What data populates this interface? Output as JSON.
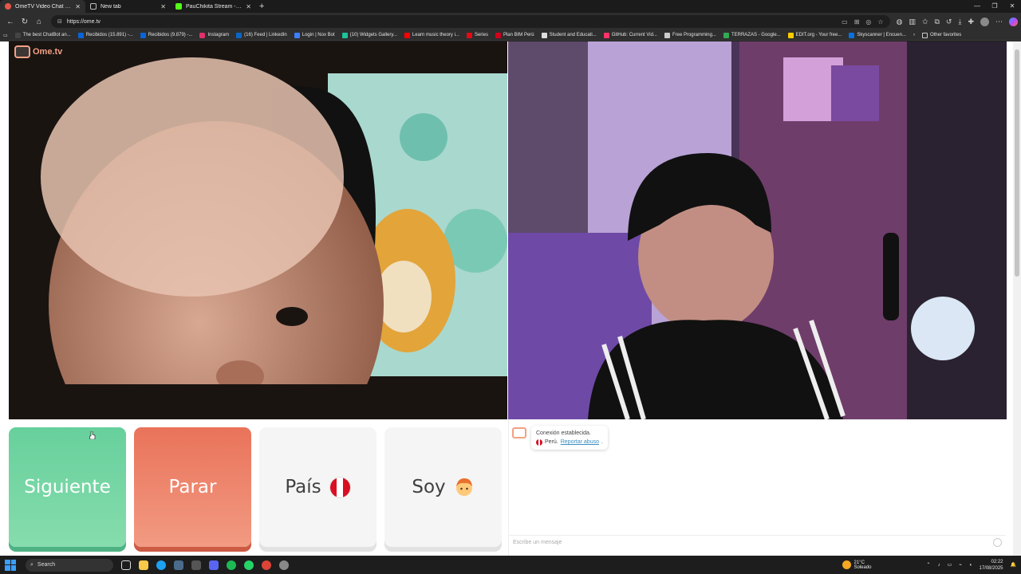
{
  "browser": {
    "tabs": [
      {
        "label": "OmeTV Video Chat — Ome.tv",
        "icon_color": "#e6564a",
        "active": true
      },
      {
        "label": "New tab",
        "icon_color": "#bdbdbd",
        "active": false
      },
      {
        "label": "PauChikita Stream - Watch Live o",
        "icon_color": "#53fc18",
        "active": false
      }
    ],
    "new_tab": "+",
    "url": "https://ome.tv",
    "bookmarks": [
      {
        "label": "The best ChatBot an...",
        "color": "#222222"
      },
      {
        "label": "Recibidos (15.891) -...",
        "color": "#ffffff"
      },
      {
        "label": "Recibidos (9.879) -...",
        "color": "#ffffff"
      },
      {
        "label": "Instagram",
        "color": "#e1306c"
      },
      {
        "label": "(16) Feed | LinkedIn",
        "color": "#0a66c2"
      },
      {
        "label": "Login | Nox Bot",
        "color": "#3d7eff"
      },
      {
        "label": "(10) Widgets Gallery...",
        "color": "#1dc39a"
      },
      {
        "label": "Learn music theory i...",
        "color": "#ff0000"
      },
      {
        "label": "Series",
        "color": "#e50914"
      },
      {
        "label": "Plan BIM Perú",
        "color": "#d0021b"
      },
      {
        "label": "Student and Educati...",
        "color": "#ffffff"
      },
      {
        "label": "GitHub: Current Vid...",
        "color": "#ff3366"
      },
      {
        "label": "Free Programming...",
        "color": "#ffffff"
      },
      {
        "label": "TERRAZAS - Google...",
        "color": "#34a853"
      },
      {
        "label": "EDIT.org - Your free...",
        "color": "#ffcc00"
      },
      {
        "label": "Skyscanner | Encuen...",
        "color": "#0770e3"
      }
    ],
    "other_favorites": "Other favorites"
  },
  "site": {
    "logo_text": "Ome.tv",
    "brand_color": "#f3a185"
  },
  "controls": {
    "next_label": "Siguiente",
    "stop_label": "Parar",
    "country_label": "País",
    "gender_label": "Soy"
  },
  "chat": {
    "status": "Conexión establecida.",
    "country": "Perú.",
    "report_link": "Reportar abuso",
    "report_suffix": ".",
    "input_placeholder": "Escribe un mensaje"
  },
  "taskbar": {
    "search_placeholder": "Search",
    "temperature": "21°C",
    "weather": "Soleado",
    "time": "02:22",
    "date": "17/08/2025"
  }
}
